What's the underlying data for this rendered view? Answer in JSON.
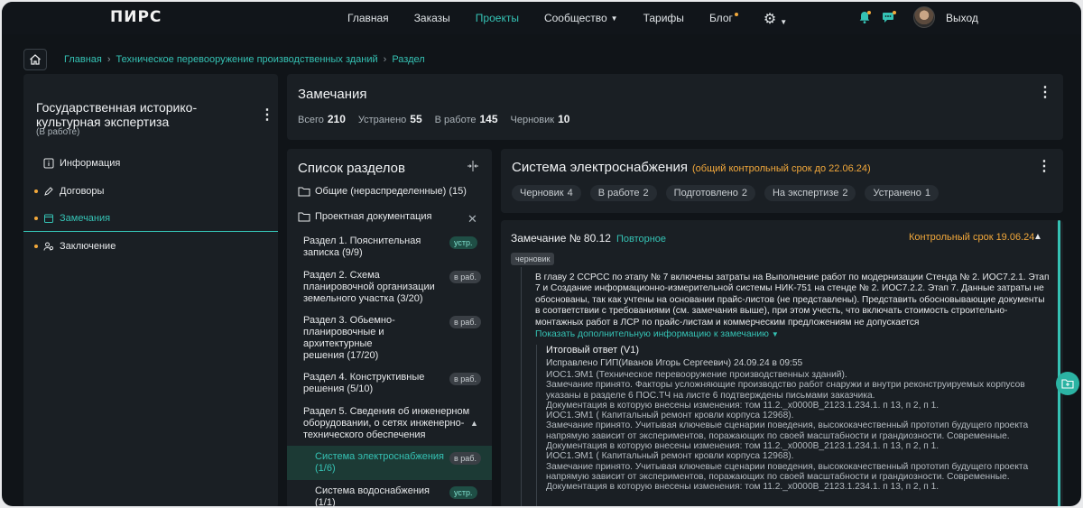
{
  "app": {
    "logo": "ПИРС"
  },
  "nav": {
    "items": [
      {
        "label": "Главная",
        "active": false
      },
      {
        "label": "Заказы",
        "active": false
      },
      {
        "label": "Проекты",
        "active": true
      },
      {
        "label": "Сообщество",
        "active": false
      },
      {
        "label": "Тарифы",
        "active": false
      },
      {
        "label": "Блог",
        "active": false
      }
    ],
    "exit": "Выход"
  },
  "breadcrumb": [
    "Главная",
    "Техническое перевооружение производственных зданий",
    "Раздел"
  ],
  "left": {
    "title": "Государственная историко-культурная экспертиза",
    "status": "(В работе)",
    "items": [
      {
        "label": "Информация",
        "icon": "info-icon",
        "dot": false,
        "active": false
      },
      {
        "label": "Договоры",
        "icon": "pen-icon",
        "dot": true,
        "active": false
      },
      {
        "label": "Замечания",
        "icon": "calendar-icon",
        "dot": true,
        "active": true
      },
      {
        "label": "Заключение",
        "icon": "users-icon",
        "dot": true,
        "active": false
      }
    ]
  },
  "notes": {
    "title": "Замечания",
    "stats": [
      {
        "label": "Всего",
        "value": "210"
      },
      {
        "label": "Устранено",
        "value": "55"
      },
      {
        "label": "В работе",
        "value": "145"
      },
      {
        "label": "Черновик",
        "value": "10"
      }
    ]
  },
  "sections": {
    "title": "Список разделов",
    "general": "Общие (нераспределенные) (15)",
    "project_docs": "Проектная документация",
    "items": [
      {
        "label": "Раздел 1. Пояснительная записка (9/9)",
        "badge": "устр."
      },
      {
        "label": "Раздел 2. Схема планировочной организации земельного участка (3/20)",
        "badge": "в раб."
      },
      {
        "label": "Раздел 3. Обьемно-планировочные и архитектурные решения (17/20)",
        "badge": "в раб."
      },
      {
        "label": "Раздел 4. Конструктивные решения (5/10)",
        "badge": "в раб."
      },
      {
        "label": "Раздел 5. Сведения об инженерном оборудовании, о сетях инженерно-технического обеспечения",
        "badge": ""
      }
    ],
    "sub_items": [
      {
        "label": "Система электроснабжения (1/6)",
        "badge": "в раб."
      },
      {
        "label": "Система  водоснабжения (1/1)",
        "badge": "устр."
      }
    ]
  },
  "system": {
    "title": "Система электроснабжения",
    "deadline": "(общий контрольный срок до 22.06.24)",
    "chips": [
      {
        "label": "Черновик",
        "count": "4"
      },
      {
        "label": "В работе",
        "count": "2"
      },
      {
        "label": "Подготовлено",
        "count": "2"
      },
      {
        "label": "На экспертизе",
        "count": "2"
      },
      {
        "label": "Устранено",
        "count": "1"
      }
    ]
  },
  "remark": {
    "title": "Замечание № 80.12",
    "repeat": "Повторное",
    "deadline": "Контрольный срок 19.06.24",
    "tag": "черновик",
    "text": "В главу 2 ССРСС по этапу № 7 включены затраты на Выполнение работ по модернизации Стенда № 2. ИОС7.2.1. Этап 7 и Создание информационно-измерительной системы НИК-751 на стенде № 2. ИОС7.2.2. Этап 7. Данные затраты не обоснованы, так как учтены на основании прайс-листов (не представлены). Представить обосновывающие документы в соответствии с требованиями (см. замечания выше), при этом учесть, что включать стоимость строительно-монтажных работ в ЛСР по прайс-листам и коммерческим предложениям не допускается",
    "more": "Показать дополнительную информацию к замечанию",
    "answer": {
      "title": "Итоговый ответ (V1)",
      "fixed": "Исправлено ГИП(Иванов Игорь Сергеевич) 24.09.24 в 09:55",
      "lines": [
        "ИОС1.ЭМ1 (Техническое перевооружение производственных зданий).",
        "Замечание принято. Факторы усложняющие производство работ снаружи и внутри реконструируемых корпусов указаны в разделе 6 ПОС.ТЧ на листе 6 подтверждены письмами заказчика.",
        "Документация в которую внесены изменения: том 11.2._x0000B_2123.1.234.1. п 13, п 2, п 1.",
        "ИОС1.ЭМ1 ( Капитальный ремонт кровли корпуса 12968).",
        "Замечание принято.  Учитывая ключевые сценарии поведения, высококачественный прототип будущего проекта напрямую зависит от экспериментов, поражающих по своей масштабности и грандиозности. Современные.",
        "Документация в которую внесены изменения: том 11.2._x0000B_2123.1.234.1. п 13, п 2, п 1.",
        "ИОС1.ЭМ1 ( Капитальный ремонт кровли корпуса 12968).",
        "Замечание принято. Учитывая ключевые сценарии поведения, высококачественный прототип будущего проекта напрямую зависит от экспериментов, поражающих по своей масштабности и грандиозности. Современные.",
        "Документация в которую внесены изменения: том 11.2._x0000B_2123.1.234.1. п 13, п 2, п 1."
      ]
    }
  }
}
